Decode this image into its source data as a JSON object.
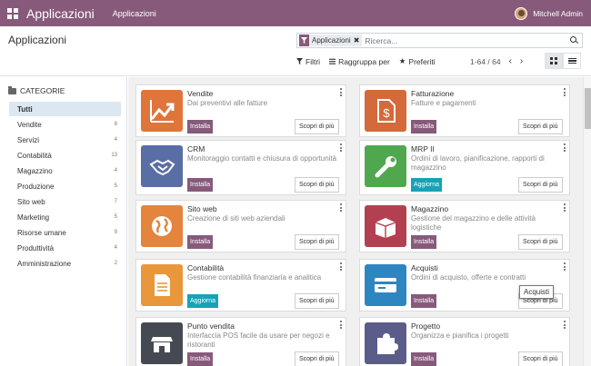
{
  "topbar": {
    "brand": "Applicazioni",
    "menu_item": "Applicazioni",
    "user_name": "Mitchell Admin",
    "bg_color": "#875a7b"
  },
  "control_panel": {
    "title": "Applicazioni",
    "search": {
      "facet_label": "Applicazioni",
      "placeholder": "Ricerca..."
    },
    "filters_label": "Filtri",
    "groupby_label": "Raggruppa per",
    "favorites_label": "Preferiti",
    "pager": "1-64 / 64"
  },
  "sidebar": {
    "heading": "CATEGORIE",
    "items": [
      {
        "label": "Tutti",
        "count": "",
        "active": true
      },
      {
        "label": "Vendite",
        "count": "8"
      },
      {
        "label": "Servizi",
        "count": "4"
      },
      {
        "label": "Contabilità",
        "count": "13"
      },
      {
        "label": "Magazzino",
        "count": "4"
      },
      {
        "label": "Produzione",
        "count": "5"
      },
      {
        "label": "Sito web",
        "count": "7"
      },
      {
        "label": "Marketing",
        "count": "5"
      },
      {
        "label": "Risorse umane",
        "count": "9"
      },
      {
        "label": "Produttività",
        "count": "4"
      },
      {
        "label": "Amministrazione",
        "count": "2"
      }
    ]
  },
  "apps": [
    {
      "name": "Vendite",
      "desc": "Dai preventivi alle fatture",
      "action": "Installa",
      "more": "Scopri di più",
      "icon": "chart-trend-icon",
      "color": "#e0753b"
    },
    {
      "name": "Fatturazione",
      "desc": "Fatture e pagamenti",
      "action": "Installa",
      "more": "Scopri di più",
      "icon": "invoice-dollar-icon",
      "color": "#d4693a"
    },
    {
      "name": "CRM",
      "desc": "Monitoraggio contatti e chiusura di opportunità",
      "action": "Installa",
      "more": "Scopri di più",
      "icon": "handshake-icon",
      "color": "#5a6ea6"
    },
    {
      "name": "MRP II",
      "desc": "Ordini di lavoro, pianificazione, rapporti di magazzino",
      "action": "Aggiorna",
      "more": "Scopri di più",
      "icon": "wrench-icon",
      "color": "#4fa84e"
    },
    {
      "name": "Sito web",
      "desc": "Creazione di siti web aziendali",
      "action": "Installa",
      "more": "Scopri di più",
      "icon": "globe-icon",
      "color": "#e4843d"
    },
    {
      "name": "Magazzino",
      "desc": "Gestione del magazzino e delle attività logistiche",
      "action": "Installa",
      "more": "Scopri di più",
      "icon": "box-icon",
      "color": "#b34050"
    },
    {
      "name": "Contabilità",
      "desc": "Gestione contabilità finanziaria e analitica",
      "action": "Aggiorna",
      "more": "Scopri di più",
      "icon": "document-icon",
      "color": "#e8973a"
    },
    {
      "name": "Acquisti",
      "desc": "Ordini di acquisto, offerte e contratti",
      "action": "Installa",
      "more": "Scopri di più",
      "icon": "credit-card-icon",
      "color": "#2e86c1"
    },
    {
      "name": "Punto vendita",
      "desc": "Interfaccia POS facile da usare per negozi e ristoranti",
      "action": "Installa",
      "more": "Scopri di più",
      "icon": "store-icon",
      "color": "#454a52"
    },
    {
      "name": "Progetto",
      "desc": "Organizza e pianifica i progetti",
      "action": "Installa",
      "more": "Scopri di più",
      "icon": "puzzle-icon",
      "color": "#5a5d8a"
    }
  ],
  "tooltip": "Acquisti"
}
